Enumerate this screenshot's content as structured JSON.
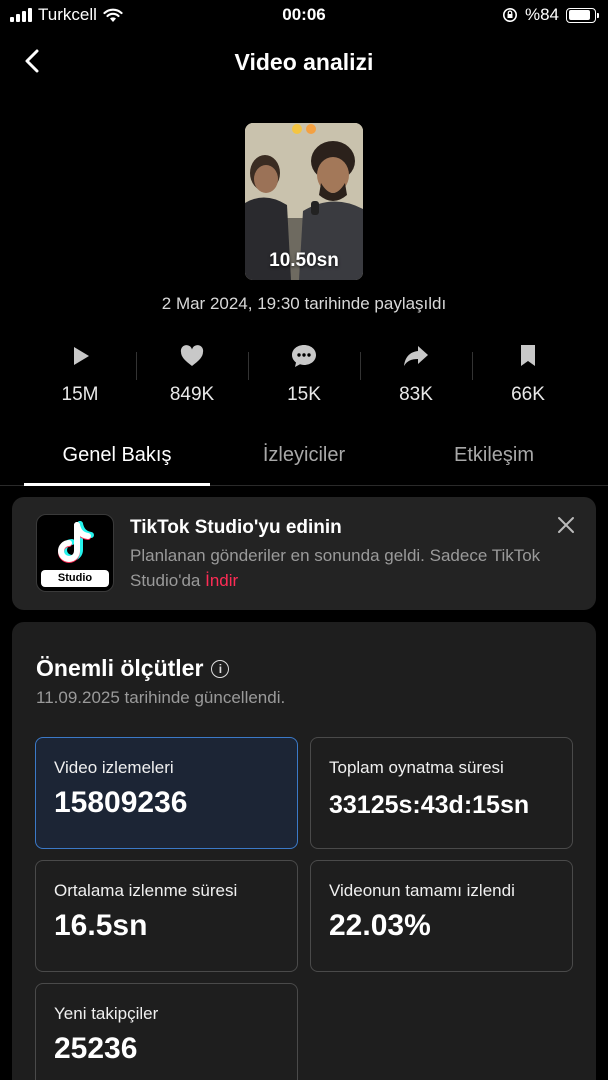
{
  "status_bar": {
    "carrier": "Turkcell",
    "time": "00:06",
    "battery": "%84",
    "battery_level": 0.84
  },
  "header": {
    "title": "Video analizi"
  },
  "video": {
    "duration": "10.50sn",
    "posted": "2 Mar 2024, 19:30 tarihinde paylaşıldı"
  },
  "stats": [
    {
      "icon": "play-icon",
      "value": "15M"
    },
    {
      "icon": "heart-icon",
      "value": "849K"
    },
    {
      "icon": "comment-icon",
      "value": "15K"
    },
    {
      "icon": "share-icon",
      "value": "83K"
    },
    {
      "icon": "bookmark-icon",
      "value": "66K"
    }
  ],
  "tabs": [
    {
      "label": "Genel Bakış",
      "active": true
    },
    {
      "label": "İzleyiciler",
      "active": false
    },
    {
      "label": "Etkileşim",
      "active": false
    }
  ],
  "promo": {
    "title": "TikTok Studio'yu edinin",
    "description": "Planlanan gönderiler en sonunda geldi. Sadece TikTok Studio'da ",
    "link": "İndir",
    "logo_label": "Studio"
  },
  "metrics": {
    "title": "Önemli ölçütler",
    "updated": "11.09.2025 tarihinde güncellendi.",
    "tiles": [
      {
        "label": "Video izlemeleri",
        "value": "15809236"
      },
      {
        "label": "Toplam oynatma süresi",
        "value": "33125s:43d:15sn"
      },
      {
        "label": "Ortalama izlenme süresi",
        "value": "16.5sn"
      },
      {
        "label": "Videonun tamamı izlendi",
        "value": "22.03%"
      },
      {
        "label": "Yeni takipçiler",
        "value": "25236"
      }
    ]
  },
  "colors": {
    "background": "#000000",
    "accent_link": "#fe2c55",
    "selected_tile_border": "#3b79c7",
    "card": "#1e1e1e"
  }
}
